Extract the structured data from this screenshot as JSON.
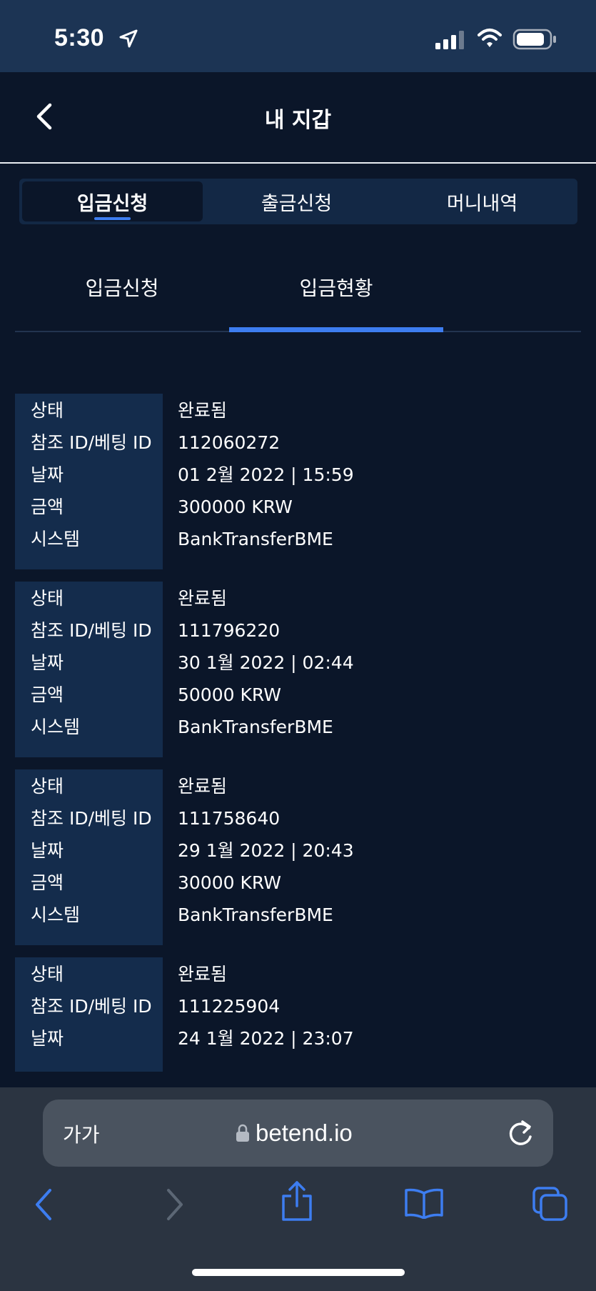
{
  "status_bar": {
    "time": "5:30"
  },
  "header": {
    "title": "내 지갑"
  },
  "main_tabs": [
    {
      "label": "입금신청",
      "active": true
    },
    {
      "label": "출금신청",
      "active": false
    },
    {
      "label": "머니내역",
      "active": false
    }
  ],
  "sub_tabs": [
    {
      "label": "입금신청",
      "active": false
    },
    {
      "label": "입금현황",
      "active": true
    }
  ],
  "records": [
    {
      "rows": [
        {
          "label": "상태",
          "value": "완료됨"
        },
        {
          "label": "참조 ID/베팅 ID",
          "value": "112060272"
        },
        {
          "label": "날짜",
          "value": "01 2월 2022 | 15:59"
        },
        {
          "label": "금액",
          "value": "300000 KRW"
        },
        {
          "label": "시스템",
          "value": "BankTransferBME"
        }
      ]
    },
    {
      "rows": [
        {
          "label": "상태",
          "value": "완료됨"
        },
        {
          "label": "참조 ID/베팅 ID",
          "value": "111796220"
        },
        {
          "label": "날짜",
          "value": "30 1월 2022 | 02:44"
        },
        {
          "label": "금액",
          "value": "50000 KRW"
        },
        {
          "label": "시스템",
          "value": "BankTransferBME"
        }
      ]
    },
    {
      "rows": [
        {
          "label": "상태",
          "value": "완료됨"
        },
        {
          "label": "참조 ID/베팅 ID",
          "value": "111758640"
        },
        {
          "label": "날짜",
          "value": "29 1월 2022 | 20:43"
        },
        {
          "label": "금액",
          "value": "30000 KRW"
        },
        {
          "label": "시스템",
          "value": "BankTransferBME"
        }
      ]
    },
    {
      "rows": [
        {
          "label": "상태",
          "value": "완료됨"
        },
        {
          "label": "참조 ID/베팅 ID",
          "value": "111225904"
        },
        {
          "label": "날짜",
          "value": "24 1월 2022 | 23:07"
        }
      ]
    }
  ],
  "browser": {
    "text_size_label": "가가",
    "url": "betend.io"
  },
  "colors": {
    "accent": "#3d7df0",
    "background": "#0b1629",
    "label_bg": "#142c4c"
  },
  "icons": [
    "location-arrow-icon",
    "cellular-signal-icon",
    "wifi-icon",
    "battery-icon",
    "chevron-left-icon",
    "lock-icon",
    "reload-icon",
    "share-icon",
    "bookmarks-icon",
    "tabs-icon",
    "chevron-right-icon"
  ]
}
